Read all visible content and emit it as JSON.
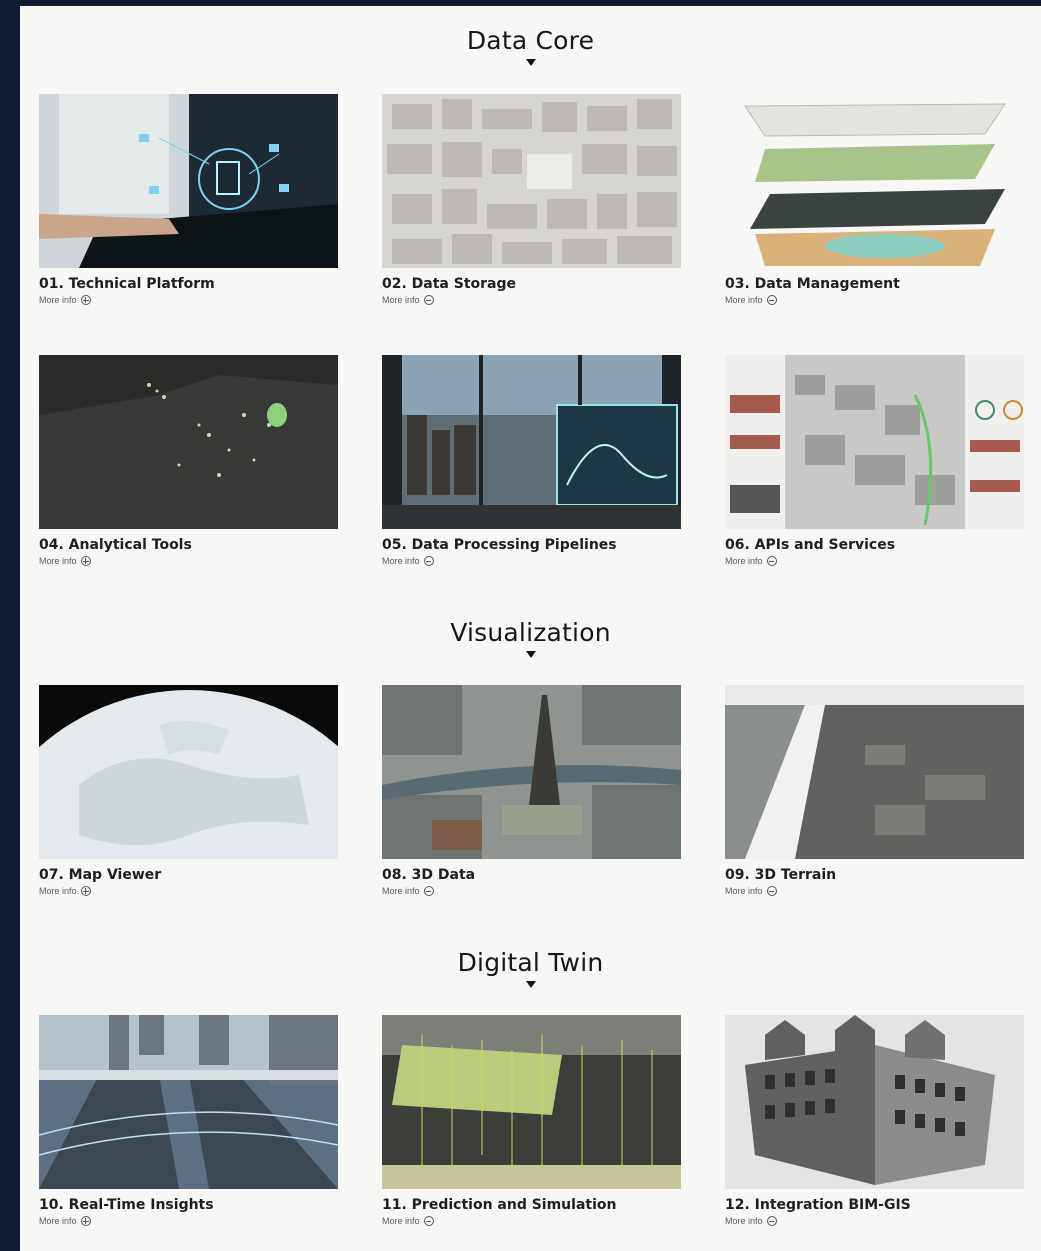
{
  "sections": [
    {
      "title": "Data Core"
    },
    {
      "title": "Visualization"
    },
    {
      "title": "Digital Twin"
    }
  ],
  "more_label": "More info",
  "cards": [
    {
      "title": "01. Technical Platform"
    },
    {
      "title": "02. Data Storage"
    },
    {
      "title": "03. Data Management"
    },
    {
      "title": "04. Analytical Tools"
    },
    {
      "title": "05. Data Processing Pipelines"
    },
    {
      "title": "06. APIs and Services"
    },
    {
      "title": "07. Map Viewer"
    },
    {
      "title": "08. 3D Data"
    },
    {
      "title": "09. 3D Terrain"
    },
    {
      "title": "10. Real-Time Insights"
    },
    {
      "title": "11. Prediction and Simulation"
    },
    {
      "title": "12. Integration BIM-GIS"
    }
  ],
  "colors": {
    "frame": "#0f1b2c",
    "panel": "#f7f7f5",
    "text": "#161616"
  }
}
